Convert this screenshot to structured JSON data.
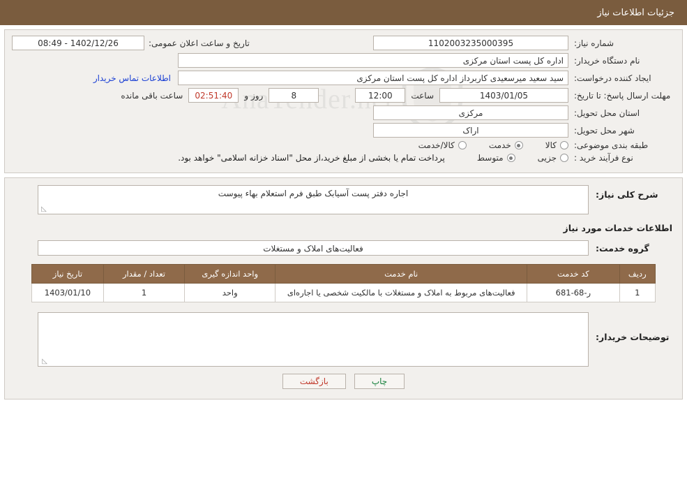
{
  "header": {
    "title": "جزئیات اطلاعات نیاز"
  },
  "form": {
    "need_number_label": "شماره نیاز:",
    "need_number_value": "1102003235000395",
    "announce_datetime_label": "تاریخ و ساعت اعلان عمومی:",
    "announce_datetime_value": "1402/12/26 - 08:49",
    "buyer_org_label": "نام دستگاه خریدار:",
    "buyer_org_value": "اداره کل پست استان مرکزی",
    "requester_label": "ایجاد کننده درخواست:",
    "requester_value": "سید سعید میرسعیدی کاربرداز اداره کل پست استان مرکزی",
    "contact_link": "اطلاعات تماس خریدار",
    "deadline_label": "مهلت ارسال پاسخ: تا تاریخ:",
    "deadline_date_value": "1403/01/05",
    "deadline_hour_label": "ساعت",
    "deadline_hour_value": "12:00",
    "days_left_value": "8",
    "days_left_label": "روز و",
    "countdown_value": "02:51:40",
    "countdown_label": "ساعت باقی مانده",
    "province_label": "استان محل تحویل:",
    "province_value": "مرکزی",
    "city_label": "شهر محل تحویل:",
    "city_value": "اراک",
    "category_label": "طبقه بندی موضوعی:",
    "category_options": [
      {
        "label": "کالا",
        "selected": false
      },
      {
        "label": "خدمت",
        "selected": true
      },
      {
        "label": "کالا/خدمت",
        "selected": false
      }
    ],
    "purchase_type_label": "نوع فرآیند خرید :",
    "purchase_type_options": [
      {
        "label": "جزیی",
        "selected": false
      },
      {
        "label": "متوسط",
        "selected": true
      }
    ],
    "purchase_note": "پرداخت تمام یا بخشی از مبلغ خرید،از محل \"اسناد خزانه اسلامی\" خواهد بود."
  },
  "details": {
    "summary_label": "شرح کلی نیاز:",
    "summary_value": "اجاره دفتر پست آسیابک طبق فرم استعلام بهاء پیوست",
    "services_heading": "اطلاعات خدمات مورد نیاز",
    "service_group_label": "گروه خدمت:",
    "service_group_value": "فعالیت‌های  املاک و مستغلات"
  },
  "table": {
    "headers": [
      "ردیف",
      "کد خدمت",
      "نام خدمت",
      "واحد اندازه گیری",
      "تعداد / مقدار",
      "تاریخ نیاز"
    ],
    "rows": [
      {
        "row": "1",
        "code": "ر-68-681",
        "name": "فعالیت‌های مربوط به املاک و مستغلات با مالکیت شخصی یا اجاره‌ای",
        "unit": "واحد",
        "qty": "1",
        "date": "1403/01/10"
      }
    ]
  },
  "buyer_notes": {
    "label": "توضیحات خریدار:",
    "value": ""
  },
  "buttons": {
    "print": "چاپ",
    "back": "بازگشت"
  },
  "watermark": {
    "text": "AnaTender.net"
  }
}
